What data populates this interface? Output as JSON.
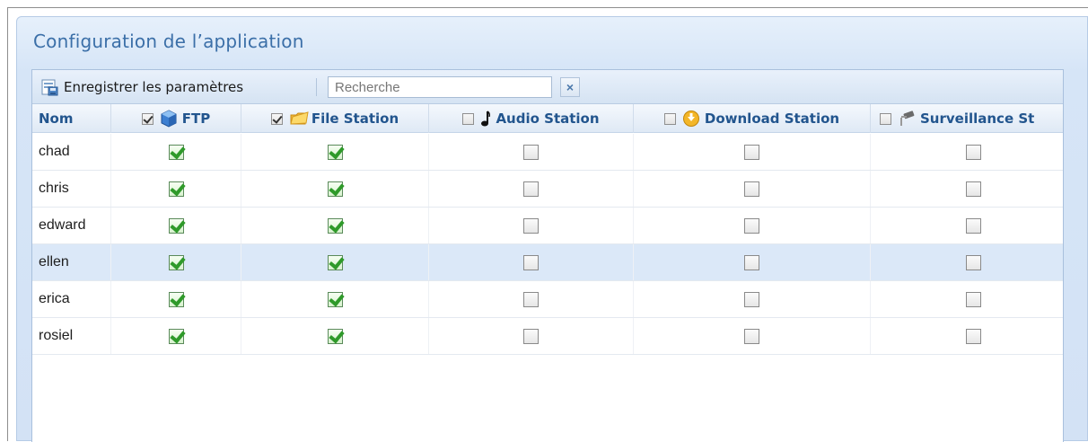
{
  "window": {
    "title": "Configuration de l’application"
  },
  "toolbar": {
    "save_label": "Enregistrer les paramètres",
    "search_placeholder": "Recherche",
    "clear_label": "×"
  },
  "columns": {
    "nom": "Nom",
    "ftp": {
      "label": "FTP",
      "checked": true,
      "icon": "ftp-cube-icon"
    },
    "file_station": {
      "label": "File Station",
      "checked": true,
      "icon": "folder-icon"
    },
    "audio_station": {
      "label": "Audio Station",
      "checked": false,
      "icon": "music-note-icon"
    },
    "download_station": {
      "label": "Download Station",
      "checked": false,
      "icon": "download-icon"
    },
    "surveillance_station": {
      "label": "Surveillance St",
      "checked": false,
      "icon": "camera-icon"
    }
  },
  "rows": [
    {
      "name": "chad",
      "ftp": true,
      "file_station": true,
      "audio_station": false,
      "download_station": false,
      "surveillance_station": false
    },
    {
      "name": "chris",
      "ftp": true,
      "file_station": true,
      "audio_station": false,
      "download_station": false,
      "surveillance_station": false
    },
    {
      "name": "edward",
      "ftp": true,
      "file_station": true,
      "audio_station": false,
      "download_station": false,
      "surveillance_station": false
    },
    {
      "name": "ellen",
      "ftp": true,
      "file_station": true,
      "audio_station": false,
      "download_station": false,
      "surveillance_station": false,
      "selected": true
    },
    {
      "name": "erica",
      "ftp": true,
      "file_station": true,
      "audio_station": false,
      "download_station": false,
      "surveillance_station": false
    },
    {
      "name": "rosiel",
      "ftp": true,
      "file_station": true,
      "audio_station": false,
      "download_station": false,
      "surveillance_station": false
    }
  ]
}
